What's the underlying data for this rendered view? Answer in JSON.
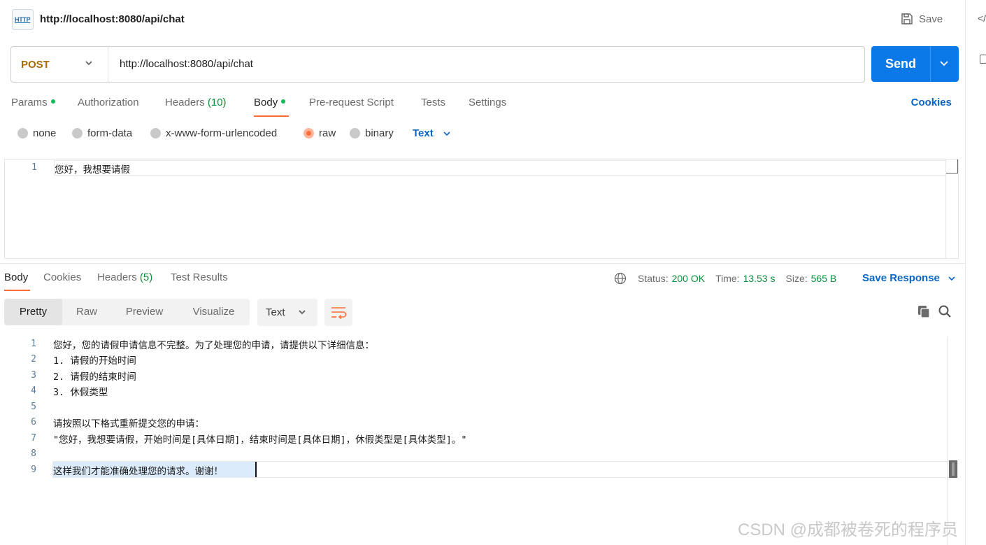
{
  "tab": {
    "icon": "http-icon",
    "icon_text": "HTTP",
    "title": "http://localhost:8080/api/chat"
  },
  "header": {
    "save_label": "Save"
  },
  "request": {
    "method": "POST",
    "url": "http://localhost:8080/api/chat",
    "send_label": "Send"
  },
  "req_tabs": [
    {
      "label": "Params",
      "dot": true
    },
    {
      "label": "Authorization"
    },
    {
      "label": "Headers",
      "count": "(10)"
    },
    {
      "label": "Body",
      "dot": true,
      "active": true
    },
    {
      "label": "Pre-request Script"
    },
    {
      "label": "Tests"
    },
    {
      "label": "Settings"
    }
  ],
  "cookies_label": "Cookies",
  "body_types": [
    {
      "label": "none",
      "selected": false
    },
    {
      "label": "form-data",
      "selected": false
    },
    {
      "label": "x-www-form-urlencoded",
      "selected": false
    },
    {
      "label": "raw",
      "selected": true
    },
    {
      "label": "binary",
      "selected": false
    }
  ],
  "raw_format": "Text",
  "request_body": [
    {
      "n": "1",
      "text": "您好，我想要请假"
    }
  ],
  "response": {
    "tabs": [
      {
        "label": "Body",
        "active": true
      },
      {
        "label": "Cookies"
      },
      {
        "label": "Headers",
        "count": "(5)"
      },
      {
        "label": "Test Results"
      }
    ],
    "status_label": "Status:",
    "status_value": "200 OK",
    "time_label": "Time:",
    "time_value": "13.53 s",
    "size_label": "Size:",
    "size_value": "565 B",
    "save_response_label": "Save Response",
    "views": [
      "Pretty",
      "Raw",
      "Preview",
      "Visualize"
    ],
    "active_view": "Pretty",
    "format": "Text",
    "lines": [
      {
        "n": "1",
        "text": "您好，您的请假申请信息不完整。为了处理您的申请，请提供以下详细信息："
      },
      {
        "n": "2",
        "text": "1. 请假的开始时间"
      },
      {
        "n": "3",
        "text": "2. 请假的结束时间"
      },
      {
        "n": "4",
        "text": "3. 休假类型"
      },
      {
        "n": "5",
        "text": ""
      },
      {
        "n": "6",
        "text": "请按照以下格式重新提交您的申请："
      },
      {
        "n": "7",
        "text": "\"您好，我想要请假，开始时间是[具体日期]，结束时间是[具体日期]，休假类型是[具体类型]。\""
      },
      {
        "n": "8",
        "text": ""
      },
      {
        "n": "9",
        "text": "这样我们才能准确处理您的请求。谢谢！"
      }
    ]
  },
  "watermark": "CSDN @成都被卷死的程序员",
  "colors": {
    "send": "#0a78e6",
    "method": "#a86b00",
    "accent": "#ff6c37",
    "link": "#0b65c2",
    "ok": "#0b8f3c"
  }
}
